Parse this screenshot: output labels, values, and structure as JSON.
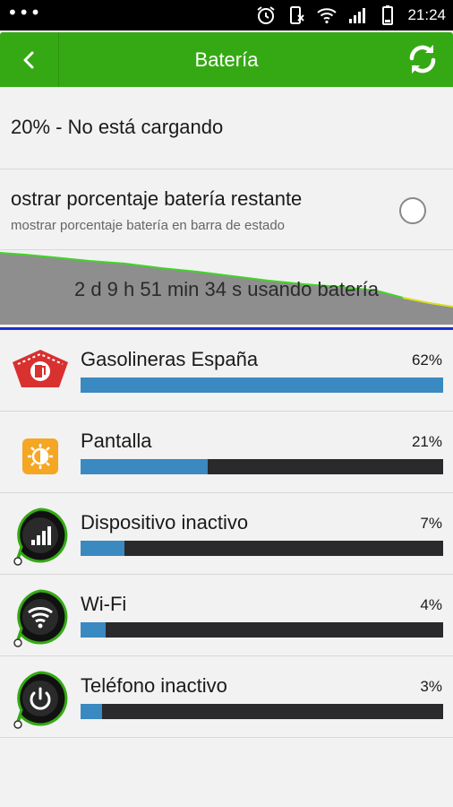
{
  "status_bar": {
    "dots": "•••",
    "time": "21:24"
  },
  "header": {
    "title": "Batería"
  },
  "battery_status": "20% - No está cargando",
  "setting": {
    "title": "ostrar porcentaje batería restante",
    "subtitle": "mostrar porcentaje batería en barra de estado",
    "checked": false
  },
  "graph": {
    "label": "2 d 9 h 51 min 34 s usando batería"
  },
  "colors": {
    "accent": "#35a914",
    "bar_fill": "#3a89c0",
    "bar_track": "#2a2a2d",
    "graph_line": "#1f2fd0"
  },
  "apps": [
    {
      "name": "Gasolineras España",
      "percent_label": "62%",
      "share": 1.0,
      "icon": "gas-station-icon"
    },
    {
      "name": "Pantalla",
      "percent_label": "21%",
      "share": 0.35,
      "icon": "screen-brightness-icon"
    },
    {
      "name": "Dispositivo inactivo",
      "percent_label": "7%",
      "share": 0.12,
      "icon": "signal-bars-icon"
    },
    {
      "name": "Wi-Fi",
      "percent_label": "4%",
      "share": 0.07,
      "icon": "wifi-icon"
    },
    {
      "name": "Teléfono inactivo",
      "percent_label": "3%",
      "share": 0.06,
      "icon": "power-icon"
    }
  ]
}
